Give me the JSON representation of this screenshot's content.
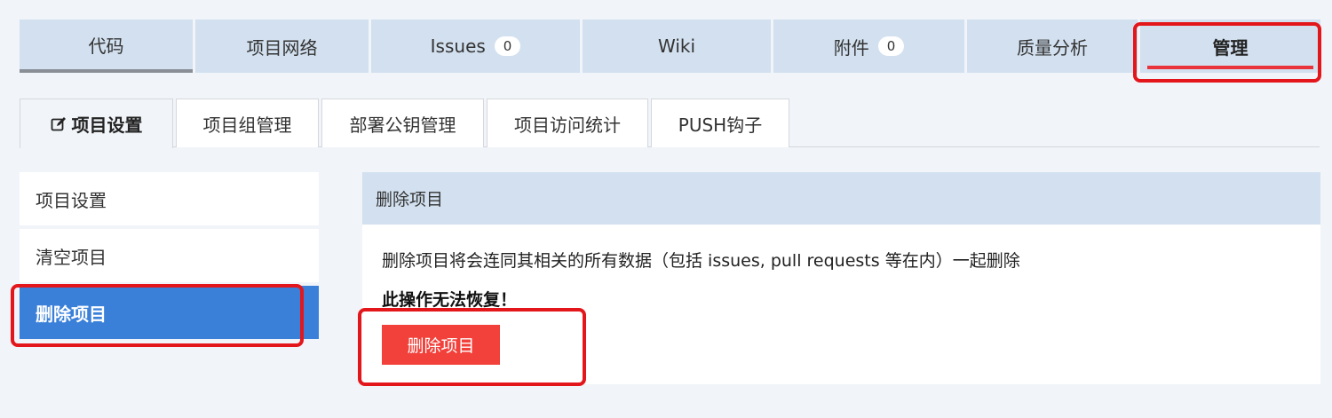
{
  "top_tabs": [
    {
      "label": "代码"
    },
    {
      "label": "项目网络"
    },
    {
      "label": "Issues",
      "badge": "0"
    },
    {
      "label": "Wiki"
    },
    {
      "label": "附件",
      "badge": "0"
    },
    {
      "label": "质量分析"
    },
    {
      "label": "管理"
    }
  ],
  "sub_tabs": [
    {
      "label": "项目设置",
      "icon": "edit-icon"
    },
    {
      "label": "项目组管理"
    },
    {
      "label": "部署公钥管理"
    },
    {
      "label": "项目访问统计"
    },
    {
      "label": "PUSH钩子"
    }
  ],
  "side_menu": [
    {
      "label": "项目设置"
    },
    {
      "label": "清空项目"
    },
    {
      "label": "删除项目"
    }
  ],
  "panel": {
    "title": "删除项目",
    "description": "删除项目将会连同其相关的所有数据（包括 issues, pull requests 等在内）一起删除",
    "warning": "此操作无法恢复！",
    "button_label": "删除项目"
  },
  "colors": {
    "tab_bg": "#d2e0ef",
    "active_side": "#3a80d9",
    "danger": "#f2403a",
    "annotation": "#e3161b"
  }
}
